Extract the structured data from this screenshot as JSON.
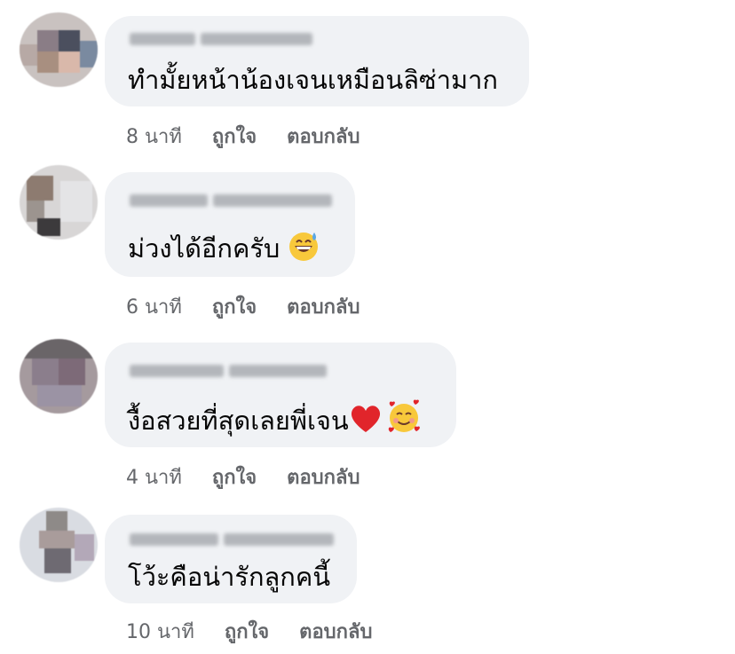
{
  "comments": [
    {
      "text": "ทำมั้ยหน้าน้องเจนเหมือนลิซ่ามาก",
      "time": "8 นาที",
      "like": "ถูกใจ",
      "reply": "ตอบกลับ",
      "emoji": []
    },
    {
      "text": "ม่วงได้อีกครับ",
      "time": "6 นาที",
      "like": "ถูกใจ",
      "reply": "ตอบกลับ",
      "emoji": [
        "grinning-sweat-emoji"
      ]
    },
    {
      "text": "งื้อสวยที่สุดเลยพี่เจน",
      "time": "4 นาที",
      "like": "ถูกใจ",
      "reply": "ตอบกลับ",
      "emoji": [
        "red-heart-emoji",
        "smiling-face-with-hearts-emoji"
      ]
    },
    {
      "text": "โว้ะคือน่ารักลูกคนี้",
      "time": "10 นาที",
      "like": "ถูกใจ",
      "reply": "ตอบกลับ",
      "emoji": []
    }
  ],
  "colors": {
    "bubble": "#f0f2f5",
    "meta": "#65676b",
    "text": "#050505"
  }
}
